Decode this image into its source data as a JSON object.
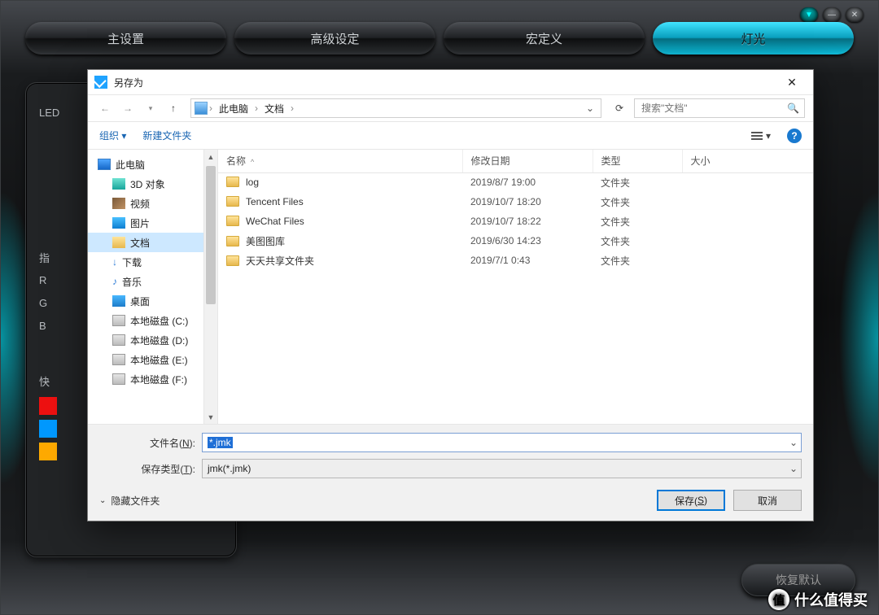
{
  "app": {
    "tabs": [
      "主设置",
      "高级设定",
      "宏定义",
      "灯光"
    ],
    "active_tab": 3,
    "side": {
      "led_label": "LED",
      "indicators": "指",
      "rows": [
        "R",
        "G",
        "B"
      ],
      "quick": "快"
    },
    "restore_default": "恢复默认"
  },
  "watermark": {
    "badge": "值",
    "text": "什么值得买"
  },
  "dialog": {
    "title": "另存为",
    "breadcrumb": [
      "此电脑",
      "文档"
    ],
    "search_placeholder": "搜索\"文档\"",
    "toolbar": {
      "organize": "组织",
      "newfolder": "新建文件夹"
    },
    "tree": [
      {
        "label": "此电脑",
        "icon": "i-pc",
        "sub": false,
        "sel": false
      },
      {
        "label": "3D 对象",
        "icon": "i-3d",
        "sub": true,
        "sel": false
      },
      {
        "label": "视频",
        "icon": "i-vid",
        "sub": true,
        "sel": false
      },
      {
        "label": "图片",
        "icon": "i-pic",
        "sub": true,
        "sel": false
      },
      {
        "label": "文档",
        "icon": "i-doc",
        "sub": true,
        "sel": true
      },
      {
        "label": "下载",
        "icon": "i-down",
        "sub": true,
        "sel": false,
        "glyph": "↓"
      },
      {
        "label": "音乐",
        "icon": "i-mus",
        "sub": true,
        "sel": false,
        "glyph": "♪"
      },
      {
        "label": "桌面",
        "icon": "i-desk",
        "sub": true,
        "sel": false
      },
      {
        "label": "本地磁盘 (C:)",
        "icon": "i-disk",
        "sub": true,
        "sel": false
      },
      {
        "label": "本地磁盘 (D:)",
        "icon": "i-disk",
        "sub": true,
        "sel": false
      },
      {
        "label": "本地磁盘 (E:)",
        "icon": "i-disk",
        "sub": true,
        "sel": false
      },
      {
        "label": "本地磁盘 (F:)",
        "icon": "i-disk",
        "sub": true,
        "sel": false
      }
    ],
    "columns": {
      "name": "名称",
      "date": "修改日期",
      "type": "类型",
      "size": "大小"
    },
    "rows": [
      {
        "name": "log",
        "date": "2019/8/7 19:00",
        "type": "文件夹"
      },
      {
        "name": "Tencent Files",
        "date": "2019/10/7 18:20",
        "type": "文件夹"
      },
      {
        "name": "WeChat Files",
        "date": "2019/10/7 18:22",
        "type": "文件夹"
      },
      {
        "name": "美图图库",
        "date": "2019/6/30 14:23",
        "type": "文件夹"
      },
      {
        "name": "天天共享文件夹",
        "date": "2019/7/1 0:43",
        "type": "文件夹"
      }
    ],
    "filename_label_pre": "文件名(",
    "filename_label_u": "N",
    "filename_label_post": "):",
    "filetype_label_pre": "保存类型(",
    "filetype_label_u": "T",
    "filetype_label_post": "):",
    "filename_value": "*.jmk",
    "filetype_value": "jmk(*.jmk)",
    "hide_folders": "隐藏文件夹",
    "save_pre": "保存(",
    "save_u": "S",
    "save_post": ")",
    "cancel": "取消"
  }
}
